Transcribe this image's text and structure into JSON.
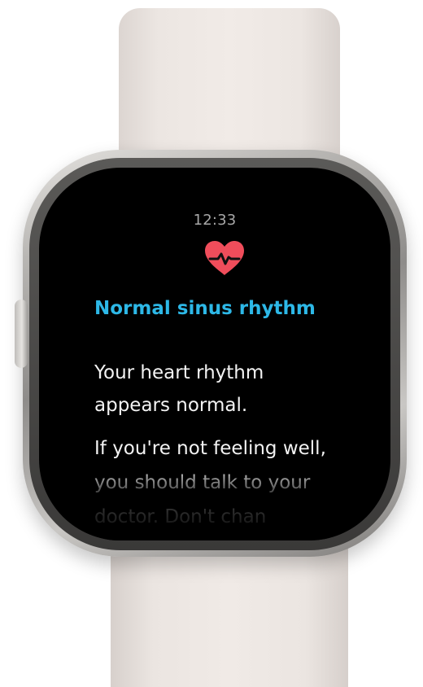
{
  "watch_screen": {
    "time": "12:33",
    "heart_icon": "heart-rhythm-icon",
    "title": "Normal sinus rhythm",
    "message_1": "Your heart rhythm appears normal.",
    "message_2": "If you're not feeling well, you should talk to your doctor. Don't chan"
  },
  "colors": {
    "screen_background": "#000000",
    "title": "#2db8e7",
    "text": "#f3f3f3",
    "time": "#a7a7a7",
    "heart": "#f04d5b",
    "band": "#ece6e2",
    "case": "#b8b6b3"
  }
}
